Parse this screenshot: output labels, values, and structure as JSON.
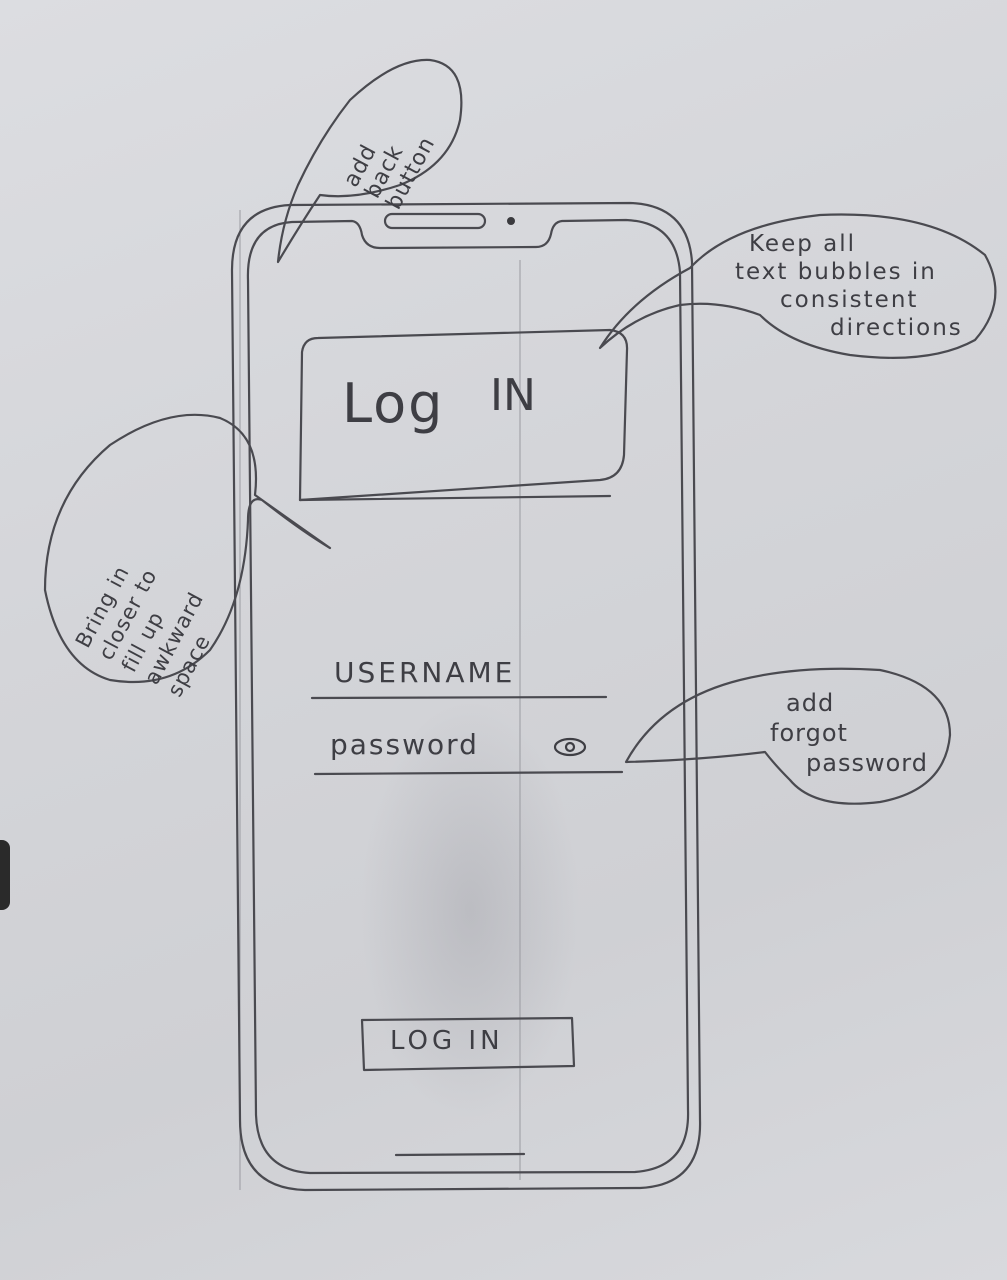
{
  "sketch": {
    "title": {
      "log": "Log",
      "in": "IN"
    },
    "fields": {
      "username_label": "USERNAME",
      "password_label": "password"
    },
    "icons": {
      "password_toggle": "eye-icon"
    },
    "login_button_label": "LOG IN"
  },
  "annotations": {
    "back_button_note": [
      "add",
      "back",
      "button"
    ],
    "bubbles_note": [
      "Keep all",
      "text bubbles in",
      "consistent",
      "directions"
    ],
    "bring_in_note": [
      "Bring in",
      "closer to",
      "fill up",
      "awkward",
      "space"
    ],
    "forgot_note": [
      "add",
      "forgot",
      "password"
    ]
  },
  "colors": {
    "paper": "#d4d5d9",
    "pencil": "#4a4a50"
  }
}
